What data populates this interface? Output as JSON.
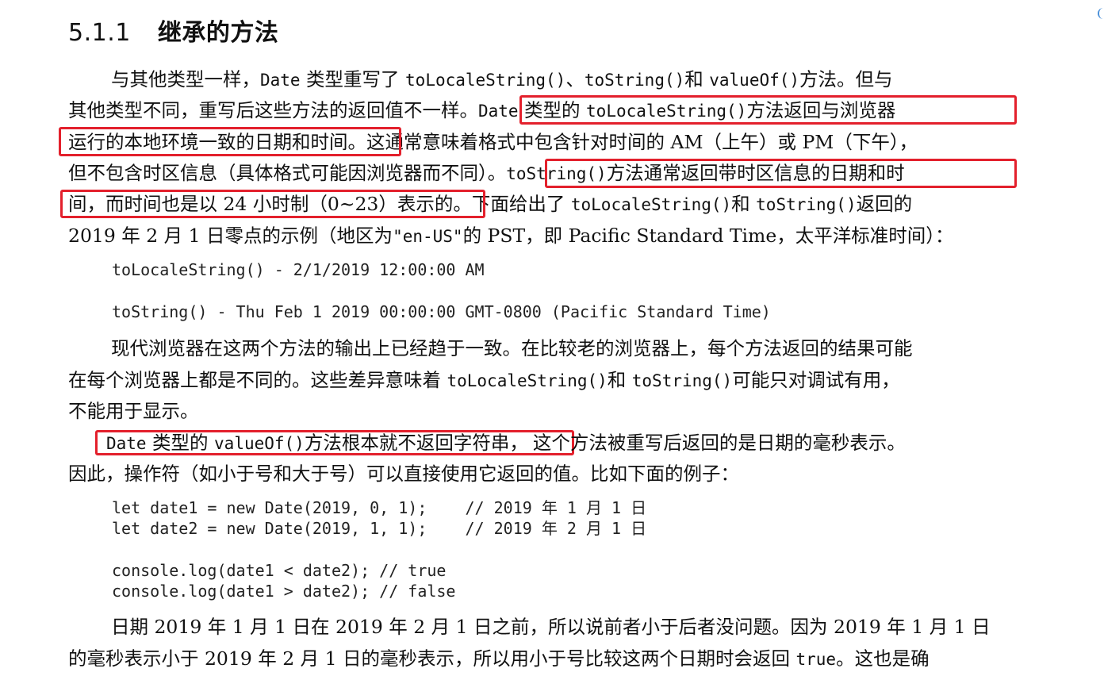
{
  "heading": {
    "number": "5.1.1",
    "title": "继承的方法"
  },
  "para1": {
    "l1": [
      "与其他类型一样，",
      "Date",
      " 类型重写了 ",
      "toLocaleString()",
      "、",
      "toString()",
      "和 ",
      "valueOf()",
      "方法。但与"
    ],
    "l2": [
      "其他类型不同，重写后这些方法的返回值不一样。",
      "Date",
      " 类型的 ",
      "toLocaleString()",
      "方法返回与浏览器"
    ],
    "l3": [
      "运行的本地环境一致的日期和时间。",
      "这通常意味着格式中包含针对时间的 AM（上午）或 PM（下午），"
    ],
    "l4": [
      "但不包含时区信息（具体格式可能因浏览器而不同）。",
      "toString()",
      "方法通常返回带时区信息的日期和时"
    ],
    "l5": [
      "间，而时间也是以 24 小时制（0~23）表示的。",
      "下面给出了 ",
      "toLocaleString()",
      "和 ",
      "toString()",
      "返回的"
    ],
    "l6": [
      "2019 年 2 月 1 日零点的示例（地区为",
      "\"en-US\"",
      "的 PST，即 Pacific Standard Time，太平洋标准时间）："
    ]
  },
  "example1": {
    "line1": "toLocaleString() - 2/1/2019 12:00:00 AM",
    "line2": "toString() - Thu Feb 1 2019 00:00:00 GMT-0800 (Pacific Standard Time)"
  },
  "para2": {
    "l1": [
      "现代浏览器在这两个方法的输出上已经趋于一致。在比较老的浏览器上，每个方法返回的结果可能"
    ],
    "l2": [
      "在每个浏览器上都是不同的。这些差异意味着 ",
      "toLocaleString()",
      "和 ",
      "toString()",
      "可能只对调试有用，"
    ],
    "l3": [
      "不能用于显示。"
    ]
  },
  "para3": {
    "l1": [
      "Date",
      " 类型的 ",
      "valueOf()",
      "方法根本就不返回字符串，",
      "这个方法被重写后返回的是日期的毫秒表示。"
    ],
    "l2": [
      "因此，操作符（如小于号和大于号）可以直接使用它返回的值。比如下面的例子："
    ]
  },
  "code": {
    "c1": "let date1 = new Date(2019, 0, 1);    // 2019 年 1 月 1 日",
    "c2": "let date2 = new Date(2019, 1, 1);    // 2019 年 2 月 1 日",
    "c3": "console.log(date1 < date2); // true",
    "c4": "console.log(date1 > date2); // false"
  },
  "para4": {
    "l1": [
      "日期 2019 年 1 月 1 日在 2019 年 2 月 1 日之前，所以说前者小于后者没问题。因为 2019 年 1 月 1 日"
    ],
    "l2": [
      "的毫秒表示小于 2019 年 2 月 1 日的毫秒表示，所以用小于号比较这两个日期时会返回 ",
      "true",
      "。这也是确"
    ]
  },
  "colors": {
    "highlight": "#e3202c",
    "text": "#111111"
  }
}
